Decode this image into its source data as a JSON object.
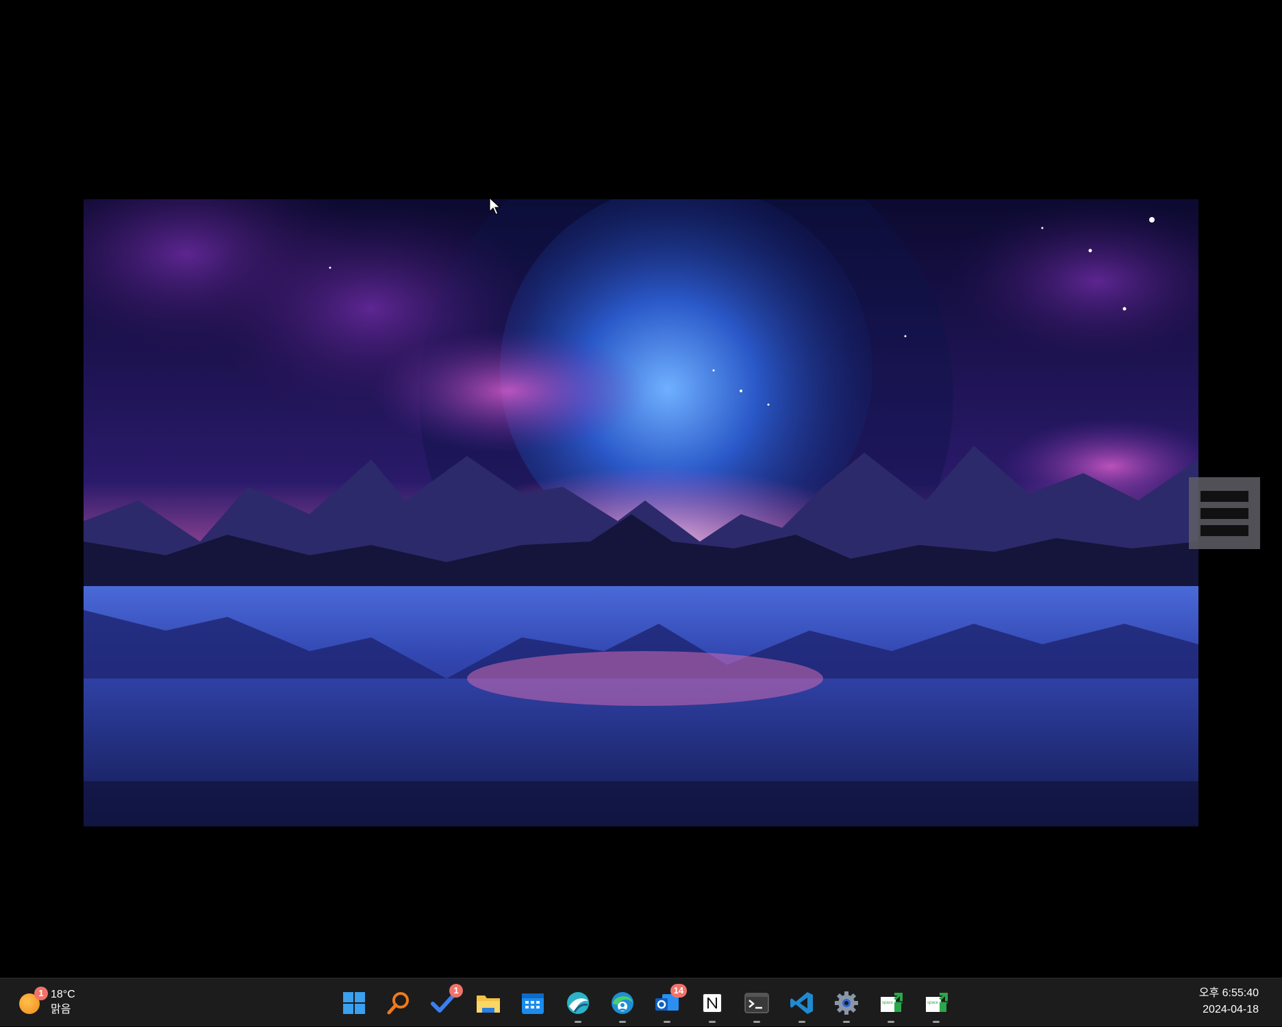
{
  "weather": {
    "temperature": "18°C",
    "condition": "맑음",
    "badge": "1"
  },
  "taskbar": {
    "apps": [
      {
        "name": "start",
        "icon": "windows-start-icon",
        "badge": "",
        "running": false
      },
      {
        "name": "search",
        "icon": "search-icon",
        "badge": "",
        "running": false
      },
      {
        "name": "todo",
        "icon": "checkmark-todo-icon",
        "badge": "1",
        "running": false
      },
      {
        "name": "file-explorer",
        "icon": "folder-icon",
        "badge": "",
        "running": false
      },
      {
        "name": "calendar",
        "icon": "calendar-icon",
        "badge": "",
        "running": false
      },
      {
        "name": "app-swirl",
        "icon": "swirl-app-icon",
        "badge": "",
        "running": true
      },
      {
        "name": "edge-profile",
        "icon": "edge-browser-icon",
        "badge": "",
        "running": true
      },
      {
        "name": "outlook",
        "icon": "outlook-icon",
        "badge": "14",
        "running": true
      },
      {
        "name": "notion",
        "icon": "notion-icon",
        "badge": "",
        "running": true
      },
      {
        "name": "terminal",
        "icon": "terminal-icon",
        "badge": "",
        "running": true
      },
      {
        "name": "vscode",
        "icon": "vscode-icon",
        "badge": "",
        "running": true
      },
      {
        "name": "settings",
        "icon": "gear-icon",
        "badge": "",
        "running": true
      },
      {
        "name": "spacedesk-1",
        "icon": "spacedesk-icon",
        "badge": "",
        "running": true
      },
      {
        "name": "spacedesk-2",
        "icon": "spacedesk-icon",
        "badge": "",
        "running": true
      }
    ],
    "spacedesk_label": "space desk"
  },
  "clock": {
    "time": "오후 6:55:40",
    "date": "2024-04-18"
  },
  "colors": {
    "taskbar_bg": "#1c1c1c",
    "badge": "#f0736a",
    "accent_blue": "#0078d4"
  }
}
